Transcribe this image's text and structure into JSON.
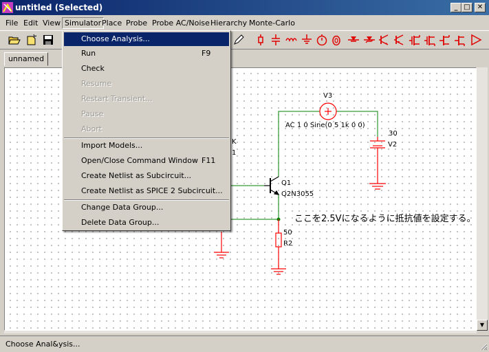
{
  "window": {
    "title": "untitled (Selected)",
    "controls": {
      "minimize": "_",
      "maximize": "□",
      "close": "✕"
    }
  },
  "menubar": {
    "items": [
      "File",
      "Edit",
      "View",
      "Simulator",
      "Place",
      "Probe",
      "Probe AC/Noise",
      "Hierarchy",
      "Monte-Carlo"
    ]
  },
  "simulator_menu": {
    "items": [
      {
        "label": "Choose Analysis...",
        "shortcut": "",
        "state": "selected"
      },
      {
        "label": "Run",
        "shortcut": "F9",
        "state": "enabled"
      },
      {
        "label": "Check",
        "shortcut": "",
        "state": "enabled"
      },
      {
        "label": "Resume",
        "shortcut": "",
        "state": "disabled"
      },
      {
        "label": "Restart Transient...",
        "shortcut": "",
        "state": "disabled"
      },
      {
        "label": "Pause",
        "shortcut": "",
        "state": "disabled"
      },
      {
        "label": "Abort",
        "shortcut": "",
        "state": "disabled"
      },
      {
        "label": "Import Models...",
        "shortcut": "",
        "state": "enabled"
      },
      {
        "label": "Open/Close Command Window",
        "shortcut": "F11",
        "state": "enabled"
      },
      {
        "label": "Create Netlist as Subcircuit...",
        "shortcut": "",
        "state": "enabled"
      },
      {
        "label": "Create Netlist as SPICE 2 Subcircuit...",
        "shortcut": "",
        "state": "enabled"
      },
      {
        "label": "Change Data Group...",
        "shortcut": "",
        "state": "enabled"
      },
      {
        "label": "Delete Data Group...",
        "shortcut": "",
        "state": "enabled"
      }
    ]
  },
  "tabs": {
    "active": "unnamed"
  },
  "schematic": {
    "v3_name": "V3",
    "v3_value": "AC 1 0 Sine(0 5 1k 0 0)",
    "v2_value": "30",
    "v2_name": "V2",
    "q1_name": "Q1",
    "q1_model": "Q2N3055",
    "r2_value": "50",
    "r2_name": "R2",
    "left_label_top": "K",
    "left_label_bottom": "1",
    "note": "ここを2.5Vになるように抵抗値を設定する。"
  },
  "statusbar": {
    "text": "Choose Anal&ysis..."
  },
  "colors": {
    "wire": "#008000",
    "component": "#ff0000",
    "menu_highlight": "#0a246a"
  }
}
